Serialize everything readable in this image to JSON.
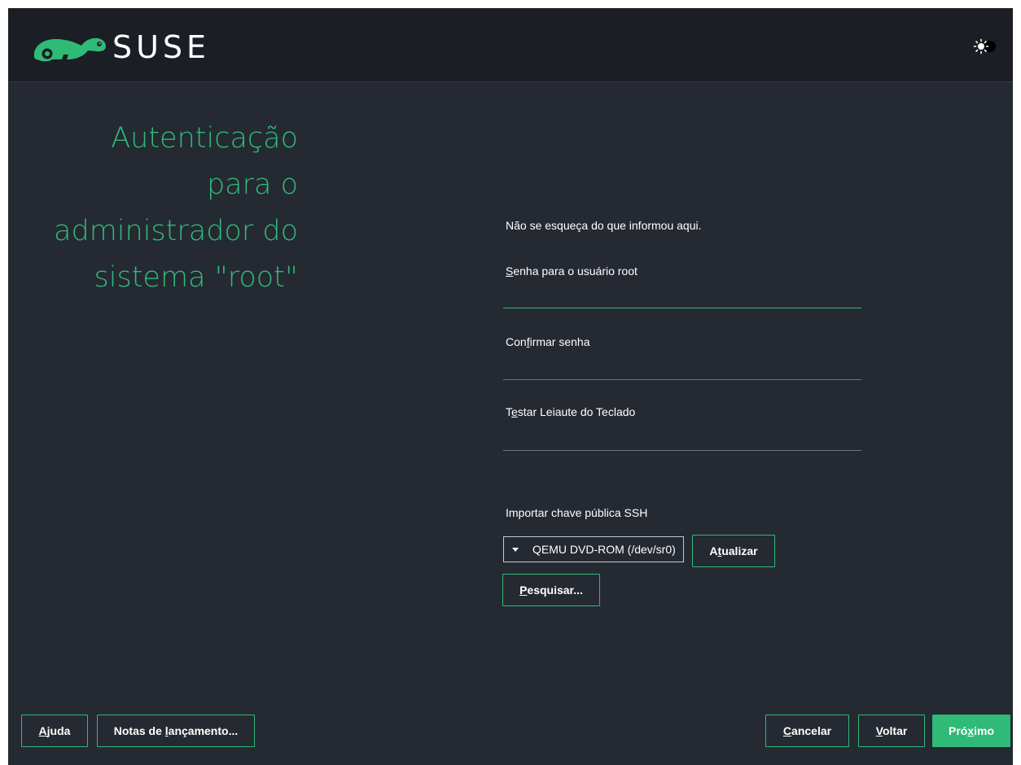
{
  "header": {
    "logo_text": "SUSE",
    "logo_icon": "chameleon-icon",
    "theme_toggle_icon": "sun-moon-toggle-icon"
  },
  "page": {
    "title_lines": [
      "Autenticação",
      "para o",
      "administrador do",
      "sistema \"root\""
    ]
  },
  "form": {
    "note": "Não se esqueça do que informou aqui.",
    "password_label": {
      "mnemonic": "S",
      "rest": "enha para o usuário root"
    },
    "confirm_label": {
      "before": "Con",
      "mnemonic": "f",
      "rest": "irmar senha"
    },
    "keyboard_label": {
      "before": "T",
      "mnemonic": "e",
      "rest": "star Leiaute do Teclado"
    },
    "ssh_label": "Importar chave pública SSH",
    "ssh_device": "QEMU  DVD-ROM (/dev/sr0)",
    "refresh_button": {
      "before": "A",
      "mnemonic": "t",
      "rest": "ualizar"
    },
    "browse_button": {
      "before": "",
      "mnemonic": "P",
      "rest": "esquisar..."
    }
  },
  "footer": {
    "help": {
      "mnemonic": "A",
      "rest": "juda"
    },
    "release_notes": {
      "before": "Notas de ",
      "mnemonic": "l",
      "rest": "ançamento..."
    },
    "cancel": {
      "mnemonic": "C",
      "rest": "ancelar"
    },
    "back": {
      "mnemonic": "V",
      "rest": "oltar"
    },
    "next": {
      "before": "Pró",
      "mnemonic": "x",
      "rest": "imo"
    }
  },
  "colors": {
    "accent": "#30ba78",
    "background": "#252932",
    "header_background": "#1b1e24"
  }
}
